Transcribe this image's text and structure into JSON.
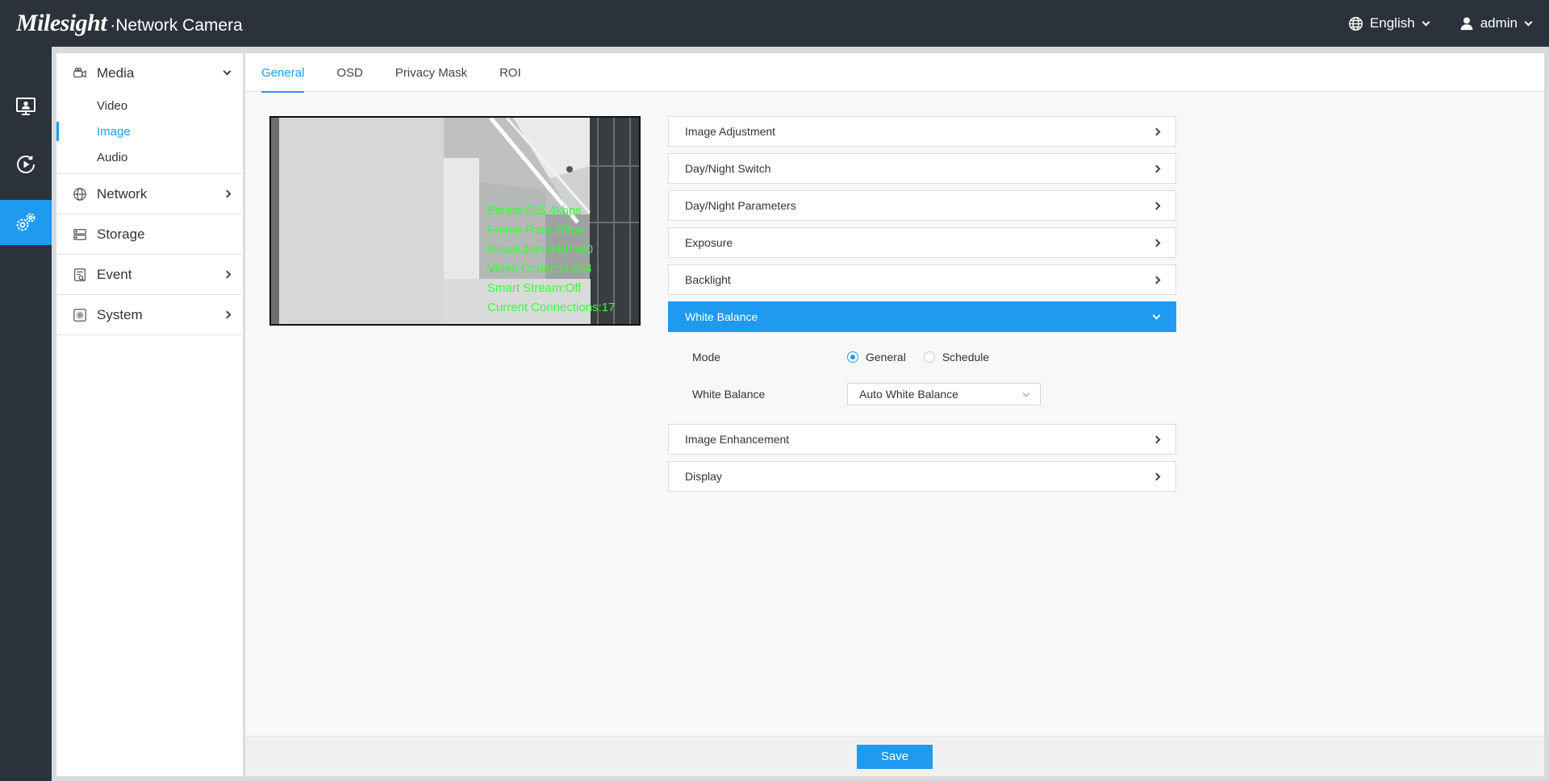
{
  "brand": {
    "name": "Milesight",
    "product": "·Network Camera"
  },
  "topbar": {
    "language": "English",
    "user": "admin"
  },
  "rail": [
    {
      "id": "live-view",
      "icon": "monitor-icon"
    },
    {
      "id": "playback",
      "icon": "play-circle-icon"
    },
    {
      "id": "settings",
      "icon": "gears-icon",
      "active": true
    }
  ],
  "sidebar": {
    "media": {
      "label": "Media",
      "items": [
        "Video",
        "Image",
        "Audio"
      ],
      "active": "Image"
    },
    "network": {
      "label": "Network"
    },
    "storage": {
      "label": "Storage"
    },
    "event": {
      "label": "Event"
    },
    "system": {
      "label": "System"
    }
  },
  "tabs": [
    "General",
    "OSD",
    "Privacy Mask",
    "ROI"
  ],
  "active_tab": "General",
  "preview": {
    "osd_lines": [
      "Bitrate:515.4kbps",
      "Frame Rate:25fps",
      "Resolution:640*480",
      "Video Codec:H.264",
      "Smart Stream:Off",
      "Current Connections:17"
    ]
  },
  "accordion": {
    "image_adjustment": "Image Adjustment",
    "day_night_switch": "Day/Night Switch",
    "day_night_parameters": "Day/Night Parameters",
    "exposure": "Exposure",
    "backlight": "Backlight",
    "white_balance": "White Balance",
    "image_enhancement": "Image Enhancement",
    "display": "Display"
  },
  "white_balance_form": {
    "mode_label": "Mode",
    "mode_options": [
      "General",
      "Schedule"
    ],
    "mode_selected": "General",
    "wb_label": "White Balance",
    "wb_value": "Auto White Balance"
  },
  "footer": {
    "save_label": "Save"
  },
  "colors": {
    "accent": "#1e9af0",
    "topbar": "#2b323b",
    "osd_text": "#33ff33"
  }
}
